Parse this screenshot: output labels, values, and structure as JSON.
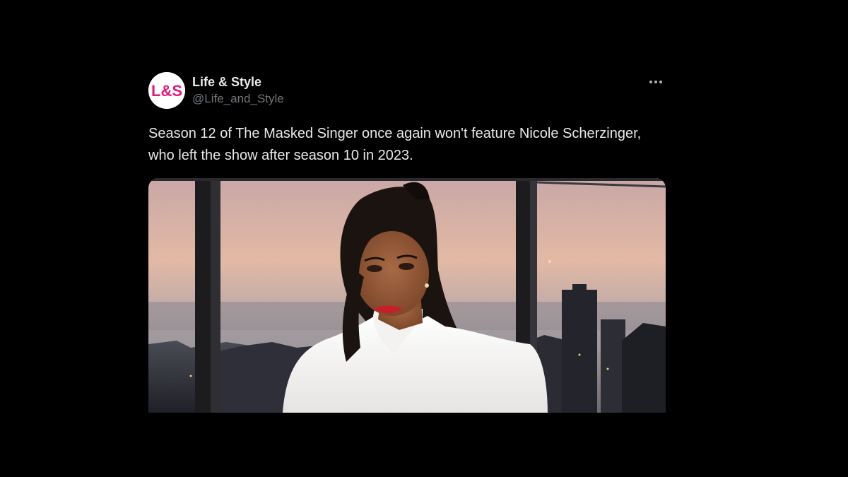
{
  "tweet": {
    "display_name": "Life & Style",
    "handle": "@Life_and_Style",
    "avatar_text": "L&S",
    "text": "Season 12 of The Masked Singer once again won't feature Nicole Scherzinger, who left the show after season 10 in 2023.",
    "more_icon": "more-horizontal-icon"
  },
  "colors": {
    "background": "#000000",
    "text_primary": "#e7e9ea",
    "text_secondary": "#71767b",
    "brand_pink": "#e6197c"
  }
}
